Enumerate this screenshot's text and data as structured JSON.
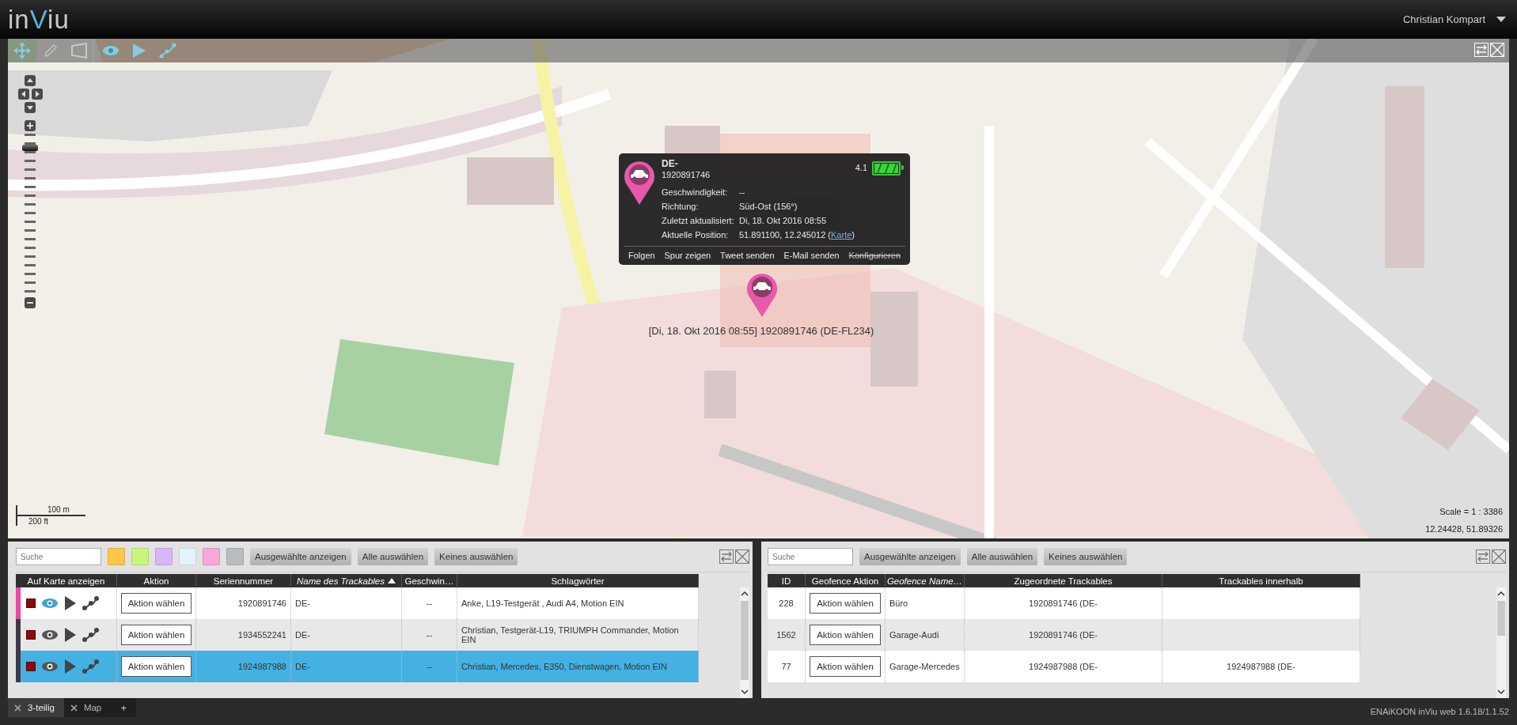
{
  "header": {
    "logo": {
      "prefix": "in",
      "accent": "V",
      "suffix": "iu"
    },
    "user": "Christian Kompart"
  },
  "map": {
    "tools": [
      {
        "kind": "move",
        "selected": true
      },
      {
        "kind": "pencil",
        "selected": false
      },
      {
        "kind": "polygon",
        "selected": false
      },
      {
        "kind": "eye",
        "selected": false
      },
      {
        "kind": "play",
        "selected": false
      },
      {
        "kind": "route",
        "selected": false
      }
    ],
    "zoom": {
      "level": 0.93
    },
    "scale_bar": {
      "metric": "100 m",
      "imperial": "200 ft"
    },
    "scale": "Scale = 1 : 3386",
    "coordinates": "12.24428, 51.89326",
    "marker": {
      "label": "[Di, 18. Okt 2016 08:55] 1920891746 (DE-FL234)"
    },
    "popup": {
      "title": "DE-",
      "subtitle": "1920891746",
      "battery": {
        "reading": "4.1",
        "level": 1
      },
      "fields": [
        {
          "label": "Geschwindigkeit:",
          "value": "--"
        },
        {
          "label": "Richtung:",
          "value": "Süd-Ost (156°)"
        },
        {
          "label": "Zuletzt aktualisiert:",
          "value": "Di, 18. Okt 2016 08:55"
        },
        {
          "label": "Aktuelle Position:",
          "value": "51.891100, 12.245012 (",
          "link": "Karte",
          "suffix": ")"
        }
      ],
      "actions": [
        {
          "label": "Folgen",
          "disabled": false
        },
        {
          "label": "Spur zeigen",
          "disabled": false
        },
        {
          "label": "Tweet senden",
          "disabled": false
        },
        {
          "label": "E-Mail senden",
          "disabled": false
        },
        {
          "label": "Konfigurieren",
          "disabled": true
        }
      ]
    }
  },
  "trackables": {
    "search": {
      "placeholder": "Suche"
    },
    "color_filters": [
      {
        "color": "#fcc84a"
      },
      {
        "color": "#c8f57e"
      },
      {
        "color": "#d9b6f7"
      },
      {
        "color": "#e2f3fc"
      },
      {
        "color": "#f7a8d8"
      },
      {
        "color": "#b9bdc0"
      }
    ],
    "buttons": [
      "Ausgewählte anzeigen",
      "Alle auswählen",
      "Keines auswählen"
    ],
    "columns": [
      {
        "label": "Auf Karte anzeigen",
        "italic": false,
        "sorted": false
      },
      {
        "label": "Aktion",
        "italic": false,
        "sorted": false
      },
      {
        "label": "Seriennummer",
        "italic": false,
        "sorted": false
      },
      {
        "label": "Name des Trackables",
        "italic": true,
        "sorted": true
      },
      {
        "label": "Geschwin…",
        "italic": false,
        "sorted": false
      },
      {
        "label": "Schlagwörter",
        "italic": false,
        "sorted": false
      }
    ],
    "rows": [
      {
        "color": "#e8489f",
        "highlighted": true,
        "action": "Aktion wählen",
        "serial": "1920891746",
        "name": "DE-",
        "speed": "--",
        "tags": "Anke, L19-Testgerät , Audi A4, Motion EIN",
        "selected": false
      },
      {
        "color": "#3c3a4a",
        "highlighted": false,
        "action": "Aktion wählen",
        "serial": "1934552241",
        "name": "DE-",
        "speed": "--",
        "tags": "Christian, Testgerät-L19, TRIUMPH Commander, Motion EIN",
        "selected": false
      },
      {
        "color": "#3c3a4a",
        "highlighted": false,
        "action": "Aktion wählen",
        "serial": "1924987988",
        "name": "DE-",
        "speed": "--",
        "tags": "Christian, Mercedes, E350, Dienstwagen, Motion EIN",
        "selected": true
      }
    ]
  },
  "geofences": {
    "search": {
      "placeholder": "Suche"
    },
    "buttons": [
      "Ausgewählte anzeigen",
      "Alle auswählen",
      "Keines auswählen"
    ],
    "columns": [
      {
        "label": "ID",
        "italic": false
      },
      {
        "label": "Geofence Aktion",
        "italic": false
      },
      {
        "label": "Geofence Name…",
        "italic": true
      },
      {
        "label": "Zugeordnete Trackables",
        "italic": false
      },
      {
        "label": "Trackables innerhalb",
        "italic": false
      }
    ],
    "rows": [
      {
        "id": "228",
        "action": "Aktion wählen",
        "name": "Büro",
        "assigned": "1920891746 (DE-",
        "selected": false
      },
      {
        "id": "1562",
        "action": "Aktion wählen",
        "name": "Garage-Audi",
        "assigned": "1920891746 (DE-",
        "selected": false
      },
      {
        "id": "77",
        "action": "Aktion wählen",
        "name": "Garage-Mercedes",
        "assigned": "1924987988 (DE-",
        "inside": "1924987988 (DE-",
        "selected": false
      }
    ]
  },
  "bottom_bar": {
    "tabs": [
      {
        "label": "3-teilig",
        "selected": true
      },
      {
        "label": "Map",
        "selected": false
      }
    ],
    "add_tab": "+",
    "version": "ENAiKOON inViu web 1.6.18/1.1.52"
  }
}
